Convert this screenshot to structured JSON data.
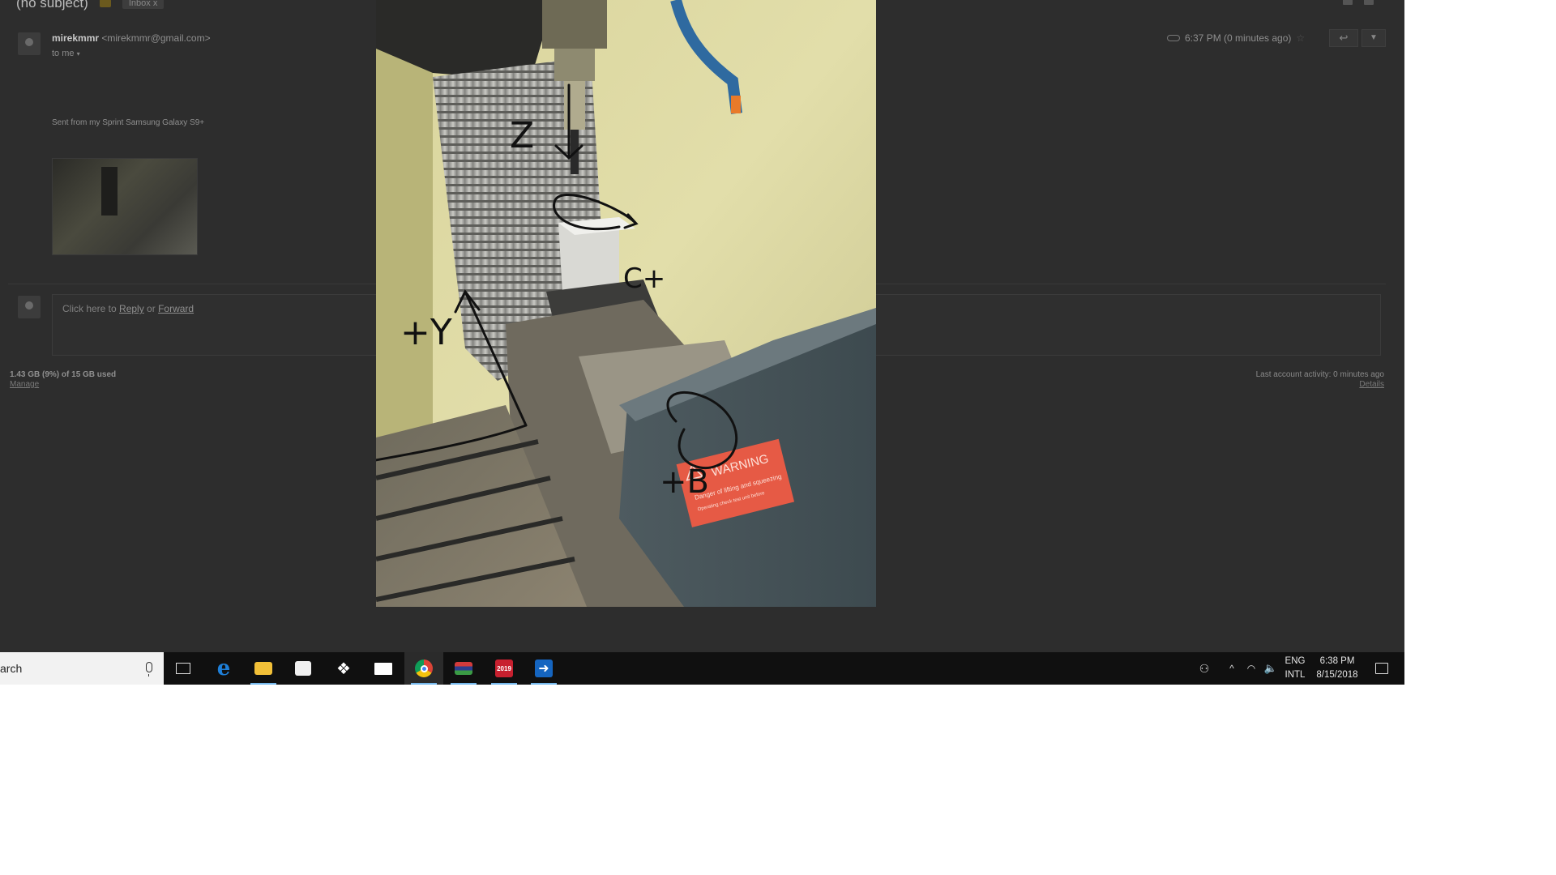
{
  "email": {
    "subject": "(no subject)",
    "inbox_label": "Inbox",
    "sender_name": "mirekmmr",
    "sender_email": "<mirekmmr@gmail.com>",
    "to": "to me",
    "time": "6:37 PM (0 minutes ago)",
    "signature": "Sent from my Sprint Samsung Galaxy S9+",
    "reply_prompt_prefix": "Click here to ",
    "reply_link": "Reply",
    "reply_or": " or ",
    "forward_link": "Forward",
    "storage": "1.43 GB (9%) of 15 GB used",
    "manage": "Manage",
    "last_activity": "Last account activity: 0 minutes ago",
    "details": "Details"
  },
  "photo": {
    "annotations": {
      "z": "Z",
      "y": "+Y",
      "c": "C+",
      "b": "+B"
    },
    "warning_title": "WARNING",
    "warning_line1": "Danger of lifting and squeezing",
    "warning_line2": "Operating check test unit before"
  },
  "taskbar": {
    "search_text": "arch",
    "icons": [
      "task-view-icon",
      "edge-icon",
      "file-explorer-icon",
      "store-icon",
      "dropbox-icon",
      "mail-icon",
      "chrome-icon",
      "app-flag-icon",
      "app-2019-icon",
      "app-arrow-icon"
    ],
    "lang_top": "ENG",
    "lang_bottom": "INTL",
    "clock_time": "6:38 PM",
    "clock_date": "8/15/2018",
    "colors": {
      "edge": "#1e7fd8",
      "explorer": "#f2c038",
      "chrome_active_underline": "#76b9ed"
    }
  }
}
